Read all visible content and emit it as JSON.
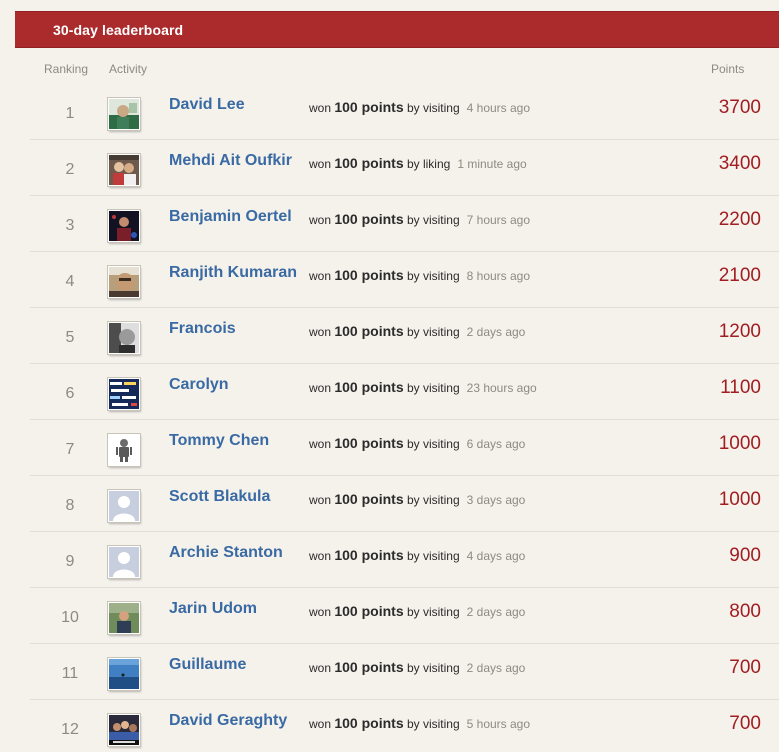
{
  "header": {
    "title": "30-day leaderboard"
  },
  "columns": {
    "ranking": "Ranking",
    "activity": "Activity",
    "points": "Points"
  },
  "rows": [
    {
      "rank": "1",
      "name": "David Lee",
      "won": "won",
      "pts_text": "100 points",
      "by": "by visiting",
      "ago": "4 hours ago",
      "points": "3700",
      "avatar": "photo-green"
    },
    {
      "rank": "2",
      "name": "Mehdi Ait Oufkir",
      "won": "won",
      "pts_text": "100 points",
      "by": "by liking",
      "ago": "1 minute ago",
      "points": "3400",
      "avatar": "photo-couple"
    },
    {
      "rank": "3",
      "name": "Benjamin Oertel",
      "won": "won",
      "pts_text": "100 points",
      "by": "by visiting",
      "ago": "7 hours ago",
      "points": "2200",
      "avatar": "photo-dark"
    },
    {
      "rank": "4",
      "name": "Ranjith Kumaran",
      "won": "won",
      "pts_text": "100 points",
      "by": "by visiting",
      "ago": "8 hours ago",
      "points": "2100",
      "avatar": "photo-face"
    },
    {
      "rank": "5",
      "name": "Francois",
      "won": "won",
      "pts_text": "100 points",
      "by": "by visiting",
      "ago": "2 days ago",
      "points": "1200",
      "avatar": "photo-bw"
    },
    {
      "rank": "6",
      "name": "Carolyn",
      "won": "won",
      "pts_text": "100 points",
      "by": "by visiting",
      "ago": "23 hours ago",
      "points": "1100",
      "avatar": "photo-text"
    },
    {
      "rank": "7",
      "name": "Tommy Chen",
      "won": "won",
      "pts_text": "100 points",
      "by": "by visiting",
      "ago": "6 days ago",
      "points": "1000",
      "avatar": "photo-robot"
    },
    {
      "rank": "8",
      "name": "Scott Blakula",
      "won": "won",
      "pts_text": "100 points",
      "by": "by visiting",
      "ago": "3 days ago",
      "points": "1000",
      "avatar": "default-silhouette"
    },
    {
      "rank": "9",
      "name": "Archie Stanton",
      "won": "won",
      "pts_text": "100 points",
      "by": "by visiting",
      "ago": "4 days ago",
      "points": "900",
      "avatar": "default-silhouette"
    },
    {
      "rank": "10",
      "name": "Jarin Udom",
      "won": "won",
      "pts_text": "100 points",
      "by": "by visiting",
      "ago": "2 days ago",
      "points": "800",
      "avatar": "photo-outdoor"
    },
    {
      "rank": "11",
      "name": "Guillaume",
      "won": "won",
      "pts_text": "100 points",
      "by": "by visiting",
      "ago": "2 days ago",
      "points": "700",
      "avatar": "photo-sky"
    },
    {
      "rank": "12",
      "name": "David Geraghty",
      "won": "won",
      "pts_text": "100 points",
      "by": "by visiting",
      "ago": "5 hours ago",
      "points": "700",
      "avatar": "photo-group"
    }
  ],
  "colors": {
    "header_bg": "#ab2b2d",
    "name": "#3a6aa3",
    "points": "#a21d22",
    "page_bg": "#f5f2ec"
  }
}
